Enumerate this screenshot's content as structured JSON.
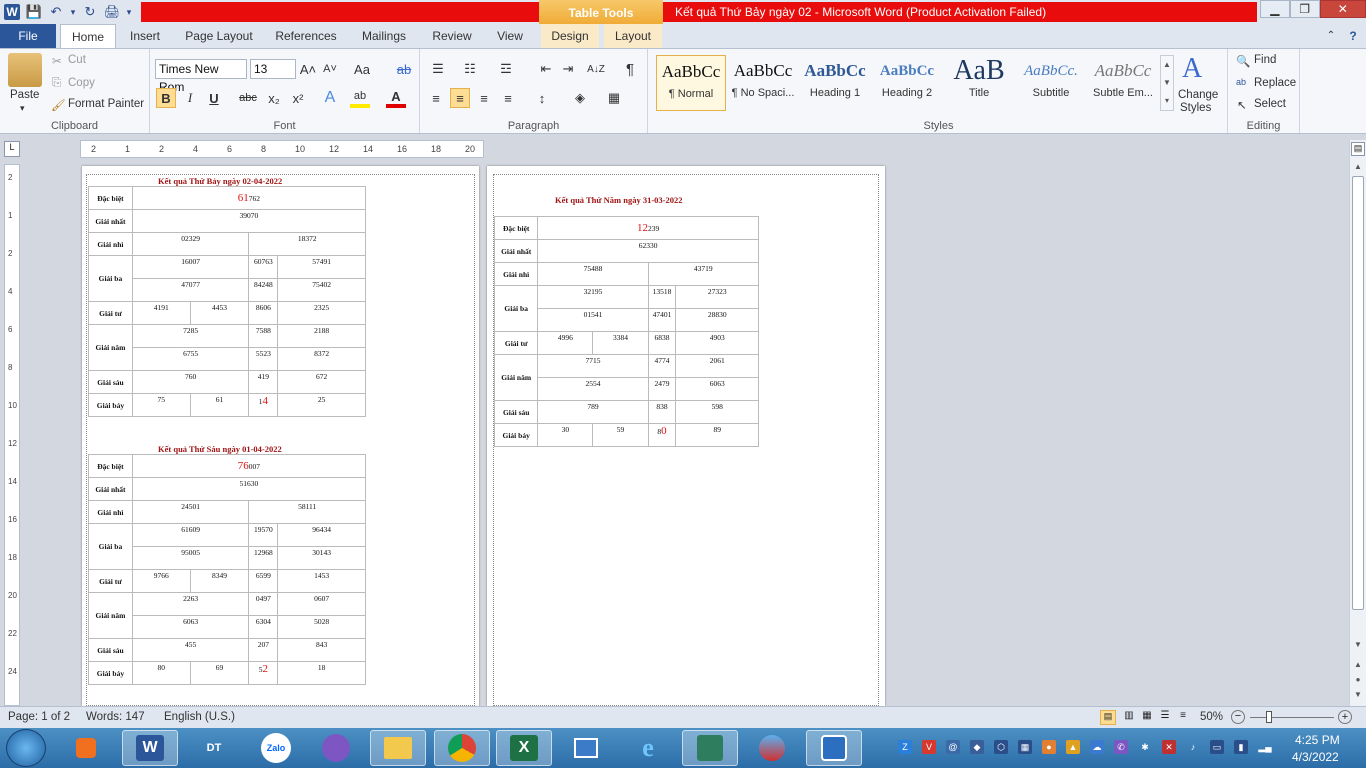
{
  "window": {
    "title": "Kết quả Thứ Bảy ngày 02 -  Microsoft Word (Product Activation Failed)",
    "context_tab": "Table Tools",
    "word_logo": "W",
    "min": "▁",
    "max": "❐",
    "close": "✕"
  },
  "qat": {
    "save": "💾",
    "undo": "↶",
    "undo_arrow": "▾",
    "redo": "↻",
    "preview": "🖨",
    "more": "▾"
  },
  "tabs": [
    "File",
    "Home",
    "Insert",
    "Page Layout",
    "References",
    "Mailings",
    "Review",
    "View",
    "Design",
    "Layout"
  ],
  "ribbon": {
    "clipboard": {
      "label": "Clipboard",
      "paste": "Paste",
      "cut": "Cut",
      "copy": "Copy",
      "painter": "Format Painter"
    },
    "font": {
      "label": "Font",
      "name": "Times New Rom",
      "size": "13",
      "grow": "A˄",
      "shrink": "A˅",
      "case": "Aa",
      "clear": "ab",
      "bold": "B",
      "italic": "I",
      "underline": "U",
      "strike": "abc",
      "sub": "x₂",
      "sup": "x²",
      "effects": "A",
      "highlight": "ab",
      "color": "A"
    },
    "paragraph": {
      "label": "Paragraph",
      "bullets": "☰",
      "numbering": "☷",
      "multilevel": "☲",
      "dec_indent": "⇤",
      "inc_indent": "⇥",
      "sort": "A↓Z",
      "pilcrow": "¶",
      "left": "≡",
      "center": "≡",
      "right": "≡",
      "justify": "≡",
      "spacing": "↕",
      "shading": "◈",
      "borders": "▦"
    },
    "styles": {
      "label": "Styles",
      "items": [
        {
          "preview": "AaBbCc",
          "name": "¶ Normal"
        },
        {
          "preview": "AaBbCc",
          "name": "¶ No Spaci..."
        },
        {
          "preview": "AaBbCc",
          "name": "Heading 1"
        },
        {
          "preview": "AaBbCc",
          "name": "Heading 2"
        },
        {
          "preview": "AaB",
          "name": "Title"
        },
        {
          "preview": "AaBbCc.",
          "name": "Subtitle"
        },
        {
          "preview": "AaBbCc",
          "name": "Subtle Em..."
        }
      ],
      "change_line1": "Change",
      "change_line2": "Styles"
    },
    "editing": {
      "label": "Editing",
      "find": "Find",
      "replace": "Replace",
      "select": "Select"
    }
  },
  "ruler": {
    "h_ticks": [
      "2",
      "1",
      "2",
      "4",
      "6",
      "8",
      "10",
      "12",
      "14",
      "16",
      "18",
      "20"
    ],
    "v_ticks": [
      "2",
      "1",
      "2",
      "4",
      "6",
      "8",
      "10",
      "12",
      "14",
      "16",
      "18",
      "20",
      "22",
      "24"
    ]
  },
  "labels": {
    "db": "Đặc biệt",
    "g1": "Giải nhất",
    "g2": "Giải nhì",
    "g3": "Giải ba",
    "g4": "Giải tư",
    "g5": "Giải năm",
    "g6": "Giải sáu",
    "g7": "Giải bảy"
  },
  "doc": {
    "t1": {
      "title": "Kết quả Thứ Bảy ngày 02-04-2022",
      "db_red": "61",
      "db_rest": "762",
      "g1": "39070",
      "g2": [
        "02329",
        "18372"
      ],
      "g3a": [
        "16007",
        "60763",
        "57491"
      ],
      "g3b": [
        "47077",
        "84248",
        "75402"
      ],
      "g4": [
        "4191",
        "4453",
        "8606",
        "2325"
      ],
      "g5a": [
        "7285",
        "7588",
        "2188"
      ],
      "g5b": [
        "6755",
        "5523",
        "8372"
      ],
      "g6": [
        "760",
        "419",
        "672"
      ],
      "g7": [
        "75",
        "61",
        "1",
        "4",
        "25"
      ]
    },
    "t2": {
      "title": "Kết quả Thứ Sáu ngày 01-04-2022",
      "db_red": "76",
      "db_rest": "007",
      "g1": "51630",
      "g2": [
        "24501",
        "58111"
      ],
      "g3a": [
        "61609",
        "19570",
        "96434"
      ],
      "g3b": [
        "95005",
        "12968",
        "30143"
      ],
      "g4": [
        "9766",
        "8349",
        "6599",
        "1453"
      ],
      "g5a": [
        "2263",
        "0497",
        "0607"
      ],
      "g5b": [
        "6063",
        "6304",
        "5028"
      ],
      "g6": [
        "455",
        "207",
        "843"
      ],
      "g7": [
        "80",
        "69",
        "5",
        "2",
        "18"
      ]
    },
    "t3": {
      "title": "Kết quả Thứ Năm ngày 31-03-2022",
      "db_red_pre": "1",
      "db_red": "2",
      "db_rest": "239",
      "g1": "62330",
      "g2": [
        "75488",
        "43719"
      ],
      "g3a": [
        "32195",
        "13518",
        "27323"
      ],
      "g3b": [
        "01541",
        "47401",
        "28830"
      ],
      "g4": [
        "4996",
        "3384",
        "6838",
        "4903"
      ],
      "g5a": [
        "7715",
        "4774",
        "2061"
      ],
      "g5b": [
        "2554",
        "2479",
        "6063"
      ],
      "g6": [
        "789",
        "838",
        "598"
      ],
      "g7": [
        "30",
        "59",
        "8",
        "0",
        "89"
      ]
    }
  },
  "status": {
    "page": "Page: 1 of 2",
    "words": "Words: 147",
    "lang": "English (U.S.)",
    "zoom": "50%"
  },
  "taskbar": {
    "word": "W",
    "dt": "DT",
    "zalo": "Zalo",
    "excel": "X",
    "time": "4:25 PM",
    "date": "4/3/2022"
  }
}
